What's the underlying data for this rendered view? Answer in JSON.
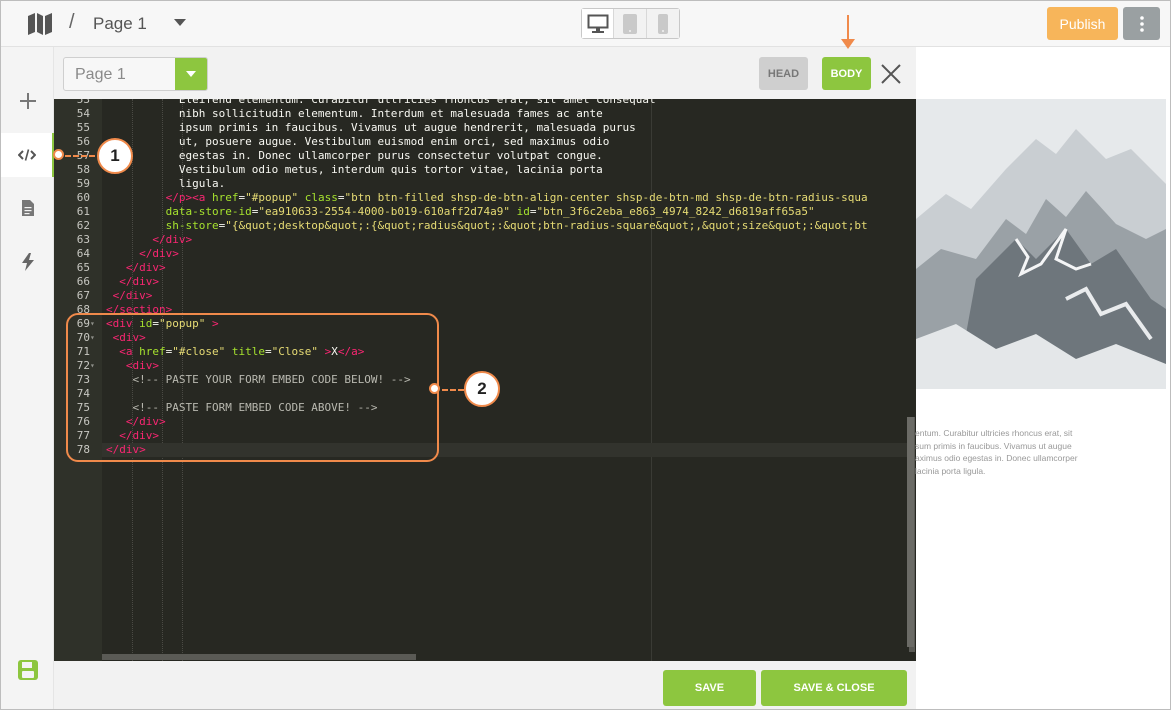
{
  "topbar": {
    "separator": "/",
    "page_title": "Page 1",
    "publish_label": "Publish"
  },
  "panel": {
    "page_select_value": "Page 1",
    "head_label": "HEAD",
    "body_label": "BODY"
  },
  "code_lines": [
    {
      "n": "53",
      "html": "           Eleifend elementum. Curabitur ultricies rhoncus erat, sit amet consequat"
    },
    {
      "n": "54",
      "html": "           nibh sollicitudin elementum. Interdum et malesuada fames ac ante"
    },
    {
      "n": "55",
      "html": "           ipsum primis in faucibus. Vivamus ut augue hendrerit, malesuada purus"
    },
    {
      "n": "56",
      "html": "           ut, posuere augue. Vestibulum euismod enim orci, sed maximus odio"
    },
    {
      "n": "57",
      "html": "           egestas in. Donec ullamcorper purus consectetur volutpat congue."
    },
    {
      "n": "58",
      "html": "           Vestibulum odio metus, interdum quis tortor vitae, lacinia porta"
    },
    {
      "n": "59",
      "html": "           ligula."
    },
    {
      "n": "60",
      "html": "         <span class=\"tg\">&lt;/p&gt;&lt;a</span> <span class=\"at\">href</span>=<span class=\"st\">\"#popup\"</span> <span class=\"at\">class</span>=<span class=\"st\">\"btn btn-filled shsp-de-btn-align-center shsp-de-btn-md shsp-de-btn-radius-squa</span>"
    },
    {
      "n": "61",
      "html": "         <span class=\"at\">data-store-id</span>=<span class=\"st\">\"ea910633-2554-4000-b019-610aff2d74a9\"</span> <span class=\"at\">id</span>=<span class=\"st\">\"btn_3f6c2eba_e863_4974_8242_d6819aff65a5\"</span>"
    },
    {
      "n": "62",
      "html": "         <span class=\"at\">sh-store</span>=<span class=\"st\">\"{&amp;quot;desktop&amp;quot;:{&amp;quot;radius&amp;quot;:&amp;quot;btn-radius-square&amp;quot;,&amp;quot;size&amp;quot;:&amp;quot;bt</span>"
    },
    {
      "n": "63",
      "html": "       <span class=\"tg\">&lt;/div&gt;</span>"
    },
    {
      "n": "64",
      "html": "     <span class=\"tg\">&lt;/div&gt;</span>"
    },
    {
      "n": "65",
      "html": "   <span class=\"tg\">&lt;/div&gt;</span>"
    },
    {
      "n": "66",
      "html": "  <span class=\"tg\">&lt;/div&gt;</span>"
    },
    {
      "n": "67",
      "html": " <span class=\"tg\">&lt;/div&gt;</span>"
    },
    {
      "n": "68",
      "html": "<span class=\"tg\">&lt;/section&gt;</span>"
    },
    {
      "n": "69",
      "fold": true,
      "html": "<span class=\"tg\">&lt;div</span> <span class=\"at\">id</span>=<span class=\"st\">\"popup\"</span> <span class=\"tg\">&gt;</span>"
    },
    {
      "n": "70",
      "fold": true,
      "html": " <span class=\"tg\">&lt;div&gt;</span>"
    },
    {
      "n": "71",
      "html": "  <span class=\"tg\">&lt;a</span> <span class=\"at\">href</span>=<span class=\"st\">\"#close\"</span> <span class=\"at\">title</span>=<span class=\"st\">\"Close\"</span> <span class=\"tg\">&gt;</span>X<span class=\"tg\">&lt;/a&gt;</span>"
    },
    {
      "n": "72",
      "fold": true,
      "html": "   <span class=\"tg\">&lt;div&gt;</span>"
    },
    {
      "n": "73",
      "html": "    <span class=\"cm\">&lt;!-- PASTE YOUR FORM EMBED CODE BELOW! --&gt;</span>"
    },
    {
      "n": "74",
      "html": ""
    },
    {
      "n": "75",
      "html": "    <span class=\"cm\">&lt;!-- PASTE FORM EMBED CODE ABOVE! --&gt;</span>"
    },
    {
      "n": "76",
      "html": "   <span class=\"tg\">&lt;/div&gt;</span>"
    },
    {
      "n": "77",
      "html": "  <span class=\"tg\">&lt;/div&gt;</span>"
    },
    {
      "n": "78",
      "current": true,
      "html": "<span class=\"tg\">&lt;/div&gt;</span>"
    }
  ],
  "footer": {
    "save_label": "SAVE",
    "save_close_label": "SAVE & CLOSE"
  },
  "preview": {
    "lines": [
      "entum. Curabitur ultricies rhoncus erat, sit",
      "sum primis in faucibus. Vivamus ut augue",
      "aximus odio egestas in. Donec ullamcorper",
      "lacinia porta ligula."
    ]
  },
  "annotations": {
    "callout_1": "1",
    "callout_2": "2",
    "accent_color": "#f08a4b"
  },
  "colors": {
    "brand_green": "#8dc63f",
    "publish_orange": "#f7b55a",
    "editor_bg": "#272822"
  },
  "icons": [
    "map-icon",
    "caret-down-icon",
    "desktop-icon",
    "tablet-icon",
    "phone-icon",
    "more-vertical-icon",
    "plus-icon",
    "code-icon",
    "document-icon",
    "lightning-icon",
    "floppy-disk-icon",
    "close-icon"
  ]
}
